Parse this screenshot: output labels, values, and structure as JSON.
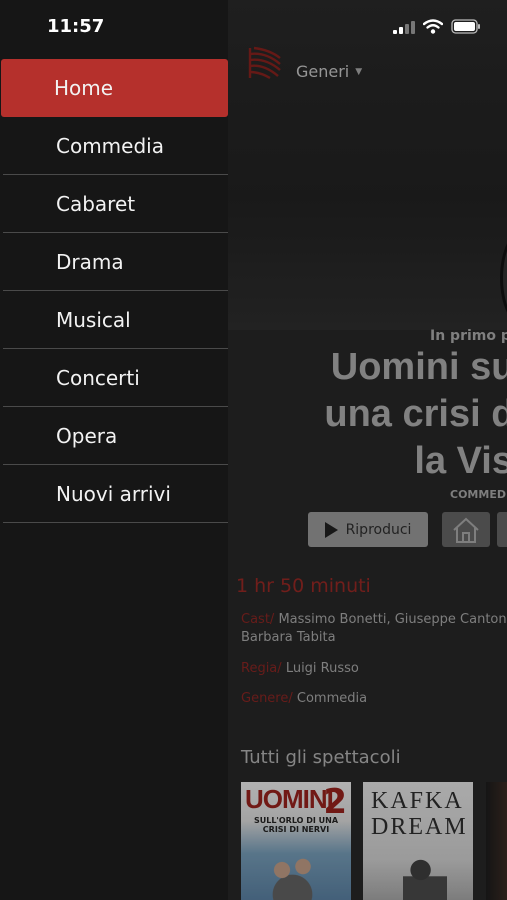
{
  "status_bar": {
    "time": "11:57"
  },
  "drawer": {
    "items": [
      {
        "label": "Home",
        "active": true
      },
      {
        "label": "Commedia"
      },
      {
        "label": "Cabaret"
      },
      {
        "label": "Drama"
      },
      {
        "label": "Musical"
      },
      {
        "label": "Concerti"
      },
      {
        "label": "Opera"
      },
      {
        "label": "Nuovi arrivi"
      }
    ]
  },
  "header": {
    "genres_label": "Generi"
  },
  "featured": {
    "label": "In primo pi",
    "title_line1": "Uomini sul",
    "title_line2": "una crisi di",
    "title_line3": "la Vis",
    "genre_tag": "COMMEDIA",
    "play_label": "Riproduci",
    "duration": "1 hr 50 minuti",
    "cast_key": "Cast/",
    "cast_value": "Massimo Bonetti,  Giuseppe Canton",
    "cast_value_2": "Barbara Tabita",
    "regia_key": "Regia/",
    "regia_value": "Luigi Russo",
    "genere_key": "Genere/",
    "genere_value": "Commedia"
  },
  "shows": {
    "section_title": "Tutti gli spettacoli",
    "posters": [
      {
        "title": "UOMINI",
        "number": "2",
        "subtitle": "SULL'ORLO DI UNA CRISI DI NERVI"
      },
      {
        "title": "KAFKA DREAM"
      }
    ]
  },
  "colors": {
    "accent": "#b5302c",
    "drawer_bg": "#161616",
    "main_bg": "#242424"
  }
}
